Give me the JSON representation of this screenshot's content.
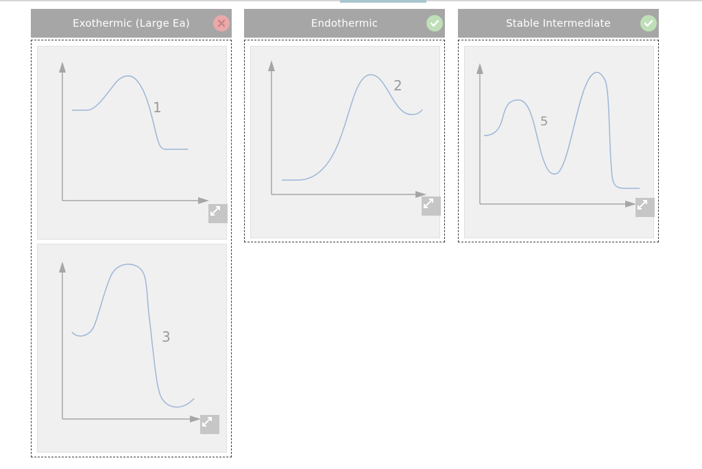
{
  "columns": [
    {
      "title": "Exothermic (Large Ea)",
      "status": "incorrect",
      "status_icon": "x-circle-icon"
    },
    {
      "title": "Endothermic",
      "status": "correct",
      "status_icon": "check-circle-icon"
    },
    {
      "title": "Stable Intermediate",
      "status": "correct",
      "status_icon": "check-circle-icon"
    }
  ],
  "cards": [
    {
      "label": "1",
      "column": 0
    },
    {
      "label": "3",
      "column": 0
    },
    {
      "label": "2",
      "column": 1
    },
    {
      "label": "5",
      "column": 2
    }
  ],
  "colors": {
    "header": "#a6a6a6",
    "curve": "#9bb6d6",
    "axis": "#a0a0a0",
    "wrong": "#eaa8a8",
    "correct": "#bfe0b7"
  }
}
